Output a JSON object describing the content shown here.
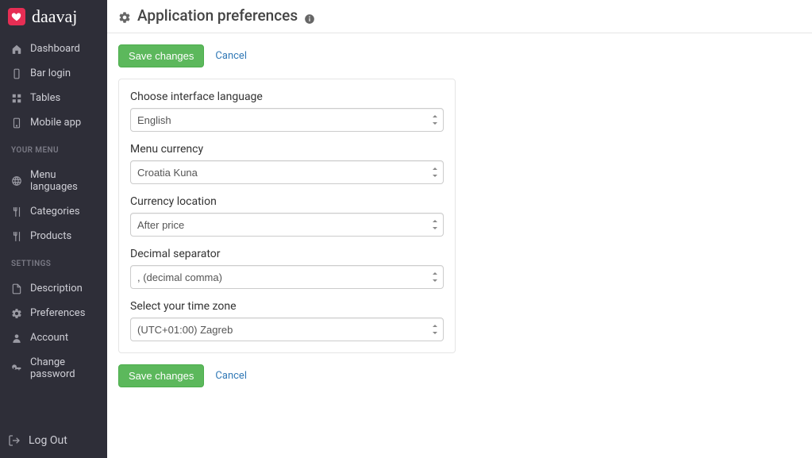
{
  "app_name": "daavaj",
  "page_title": "Application preferences",
  "nav": {
    "primary": [
      {
        "icon": "home-icon",
        "label": "Dashboard"
      },
      {
        "icon": "phone-icon",
        "label": "Bar login"
      },
      {
        "icon": "grid-icon",
        "label": "Tables"
      },
      {
        "icon": "mobile-icon",
        "label": "Mobile app"
      }
    ],
    "menu_heading": "YOUR MENU",
    "menu": [
      {
        "icon": "translate-icon",
        "label": "Menu languages"
      },
      {
        "icon": "utensils-icon",
        "label": "Categories"
      },
      {
        "icon": "utensils-icon",
        "label": "Products"
      }
    ],
    "settings_heading": "SETTINGS",
    "settings": [
      {
        "icon": "file-icon",
        "label": "Description"
      },
      {
        "icon": "gear-icon",
        "label": "Preferences"
      },
      {
        "icon": "user-icon",
        "label": "Account"
      },
      {
        "icon": "key-icon",
        "label": "Change password"
      }
    ]
  },
  "logout_label": "Log Out",
  "actions": {
    "save_label": "Save changes",
    "cancel_label": "Cancel"
  },
  "form": {
    "language": {
      "label": "Choose interface language",
      "value": "English"
    },
    "currency": {
      "label": "Menu currency",
      "value": "Croatia Kuna"
    },
    "currency_location": {
      "label": "Currency location",
      "value": "After price"
    },
    "decimal": {
      "label": "Decimal separator",
      "value": ", (decimal comma)"
    },
    "timezone": {
      "label": "Select your time zone",
      "value": "(UTC+01:00) Zagreb"
    }
  }
}
